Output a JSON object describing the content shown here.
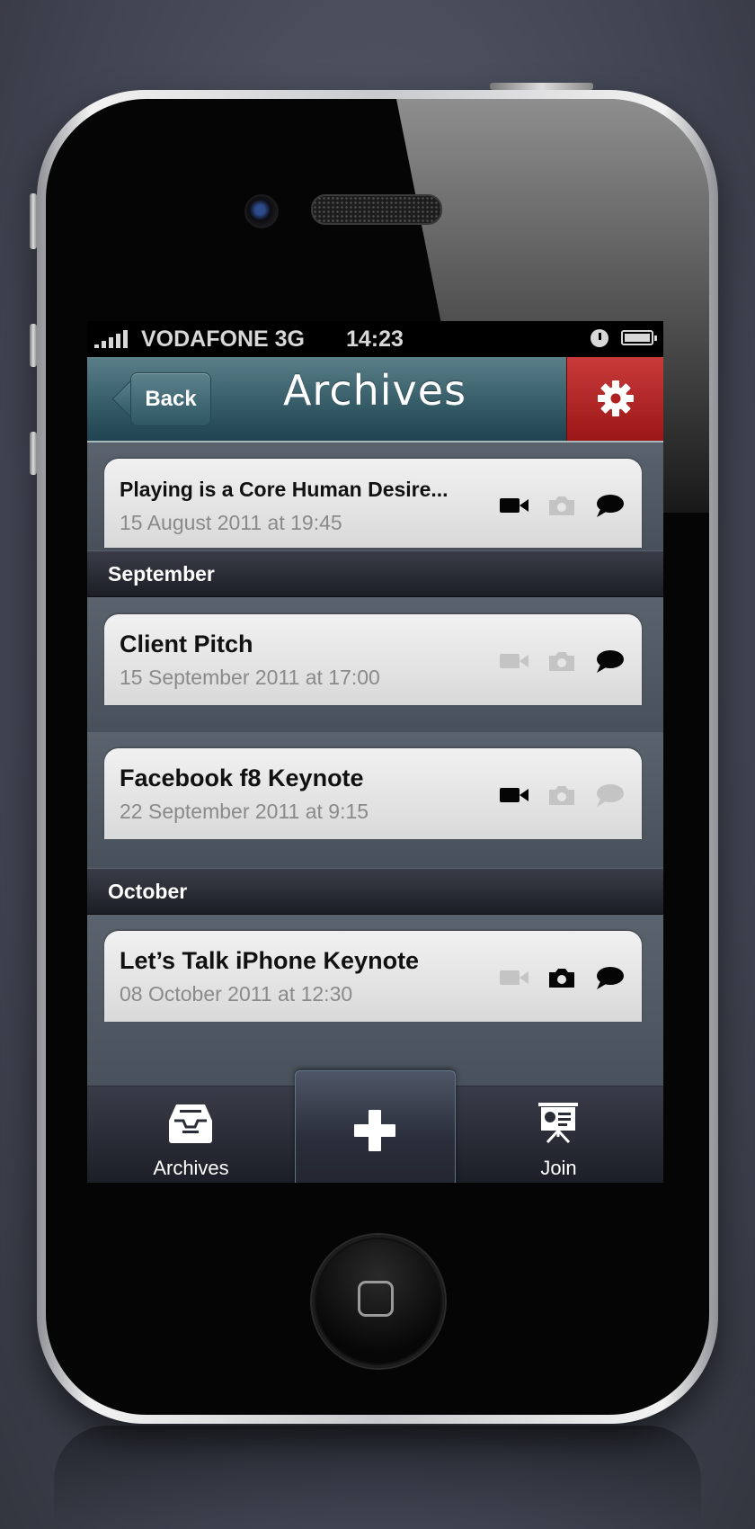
{
  "status_bar": {
    "carrier": "VODAFONE 3G",
    "time": "14:23"
  },
  "nav": {
    "back_label": "Back",
    "title": "Archives",
    "settings_icon": "gear-icon"
  },
  "colors": {
    "nav_teal": "#3c636e",
    "settings_red": "#b52323",
    "list_background": "#4d5660",
    "section_header": "#2a2d37"
  },
  "items": [
    {
      "title": "Playing is a Core Human Desire...",
      "date": "15 August 2011 at 19:45",
      "video": true,
      "photo": false,
      "comment": true
    },
    {
      "title": "Client Pitch",
      "date": "15 September 2011 at 17:00",
      "video": false,
      "photo": false,
      "comment": true
    },
    {
      "title": "Facebook f8 Keynote",
      "date": "22 September 2011 at 9:15",
      "video": true,
      "photo": false,
      "comment": false
    },
    {
      "title": "Let’s Talk iPhone Keynote",
      "date": "08 October 2011 at 12:30",
      "video": false,
      "photo": true,
      "comment": true
    }
  ],
  "sections": {
    "september": "September",
    "october": "October"
  },
  "tab_bar": {
    "archives_label": "Archives",
    "add_icon": "plus-icon",
    "join_label": "Join"
  }
}
